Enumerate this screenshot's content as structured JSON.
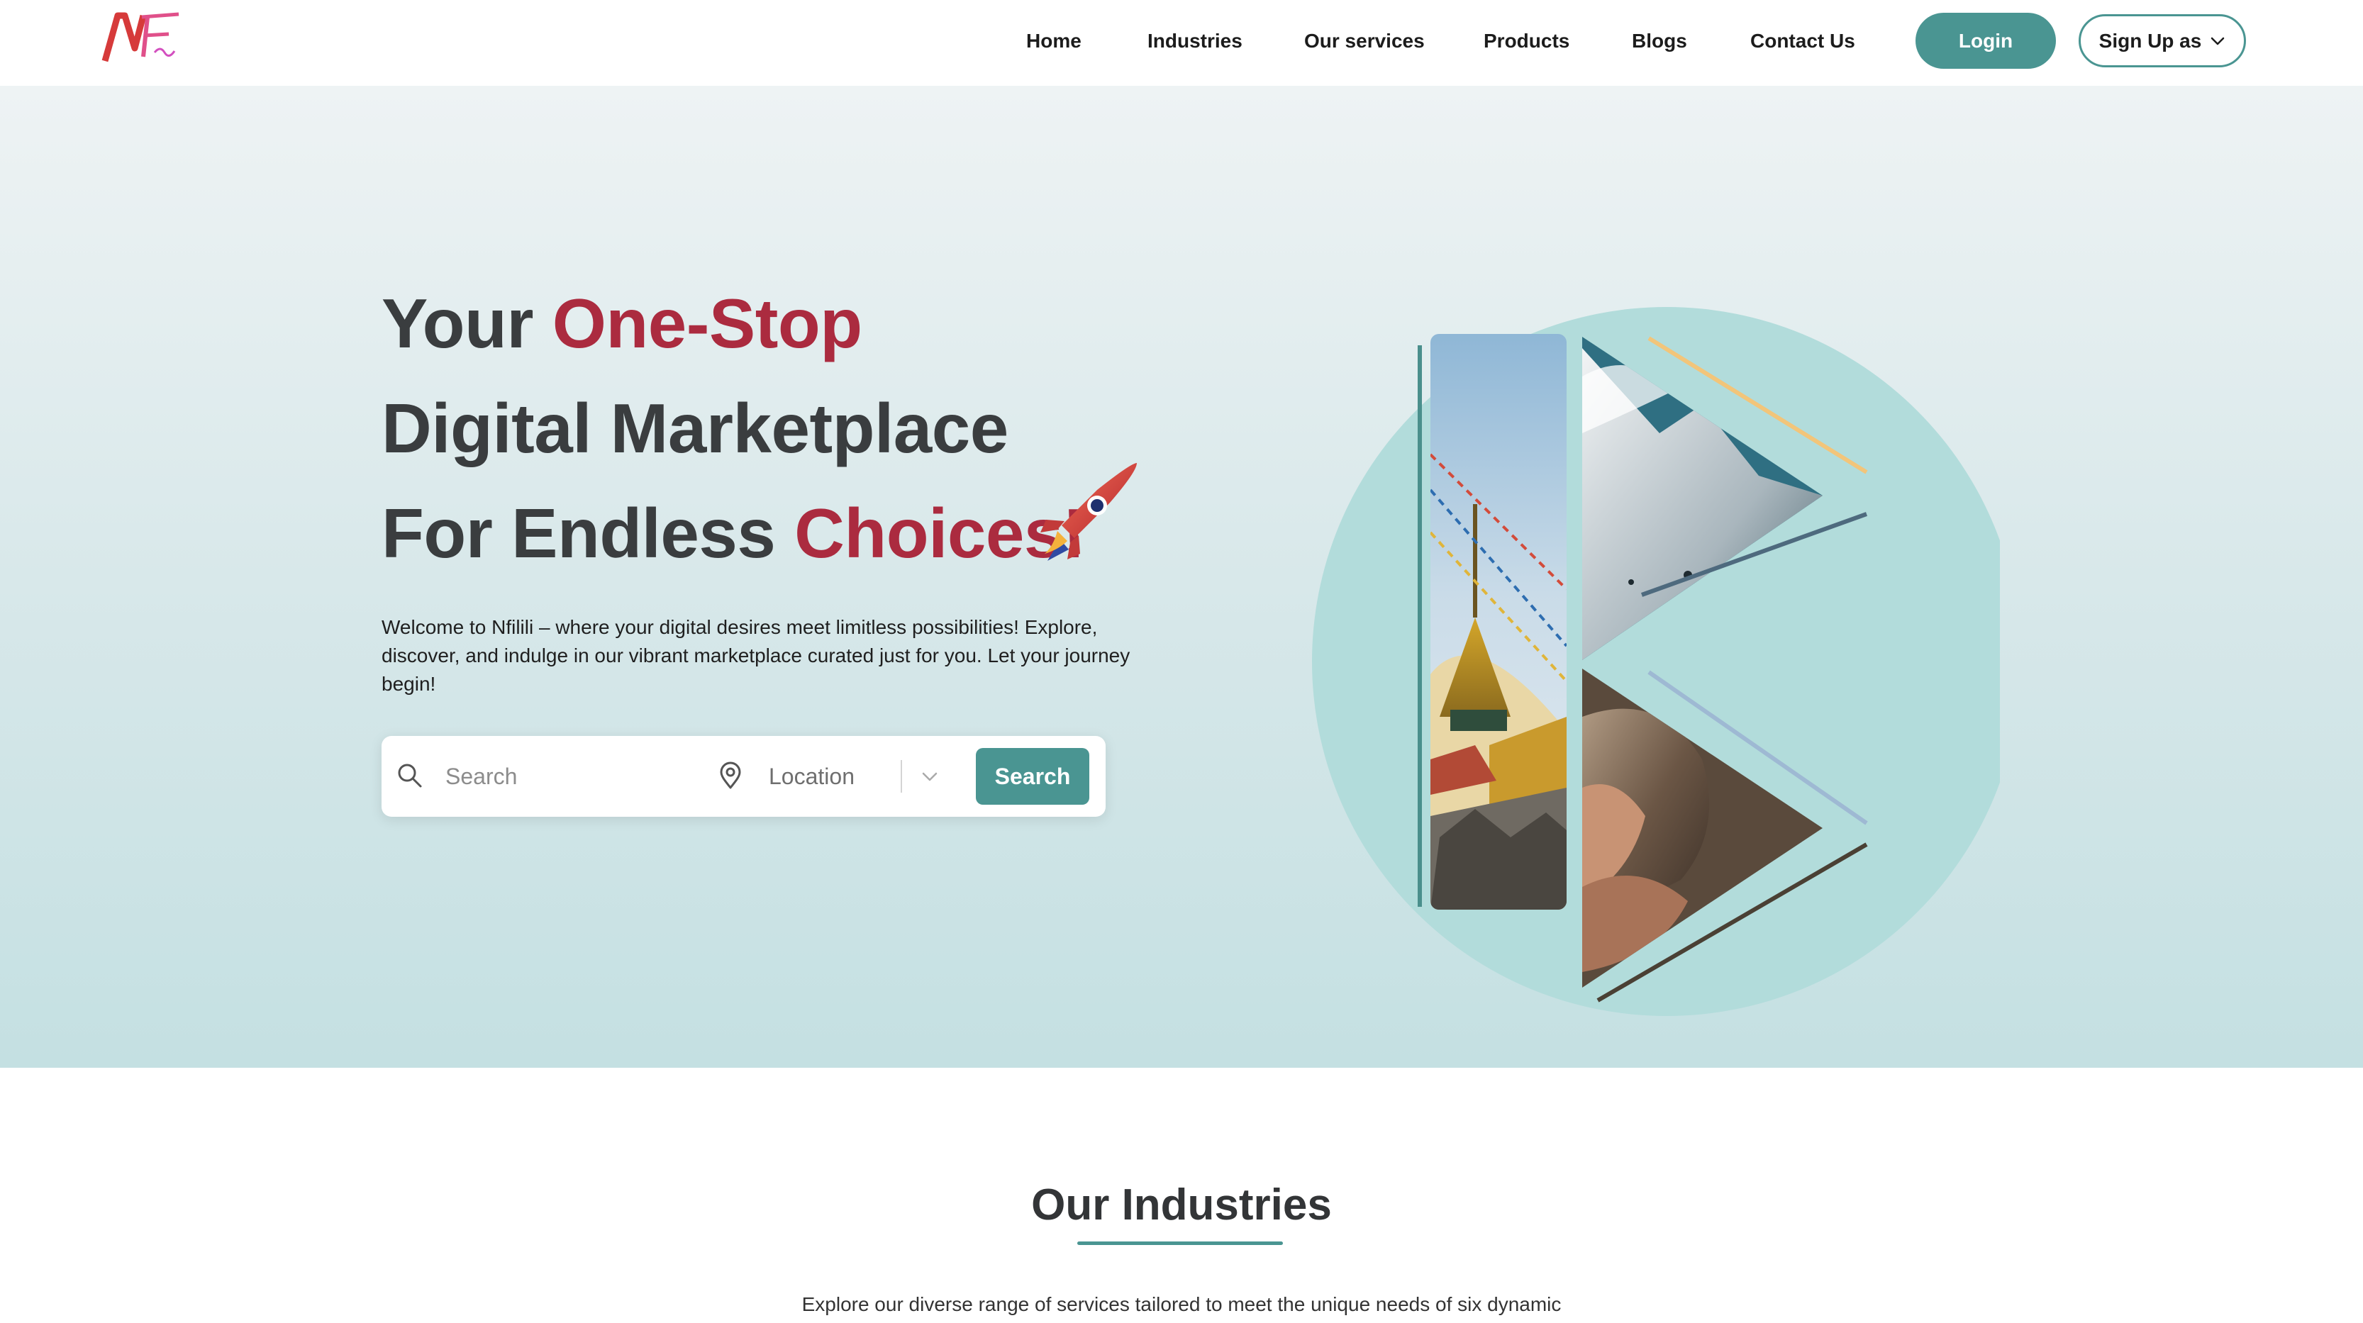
{
  "brand": {
    "logo_text": "NF"
  },
  "nav": {
    "links": [
      "Home",
      "Industries",
      "Our services",
      "Products",
      "Blogs",
      "Contact Us"
    ],
    "login_label": "Login",
    "signup_label": "Sign Up as"
  },
  "hero": {
    "line1_plain": "Your ",
    "line1_accent": "One-Stop",
    "line2": "Digital Marketplace",
    "line3_plain": "For Endless ",
    "line3_accent": "Choices!",
    "intro": "Welcome to Nfilili – where your digital desires meet limitless possibilities! Explore, discover, and indulge in our vibrant marketplace curated just for you. Let your journey begin!",
    "search": {
      "placeholder": "Search",
      "location_placeholder": "Location",
      "button_label": "Search"
    }
  },
  "industries": {
    "title": "Our Industries",
    "subtitle": "Explore our diverse range of services tailored to meet the unique needs of six dynamic"
  },
  "colors": {
    "brand_teal": "#4a9592",
    "accent_red": "#ab2b3f",
    "circle": "#b2dcdb",
    "text_dark": "#3a3d3f"
  },
  "icons": [
    "logo",
    "rocket-icon",
    "search-icon",
    "location-pin-icon",
    "chevron-down-icon"
  ]
}
